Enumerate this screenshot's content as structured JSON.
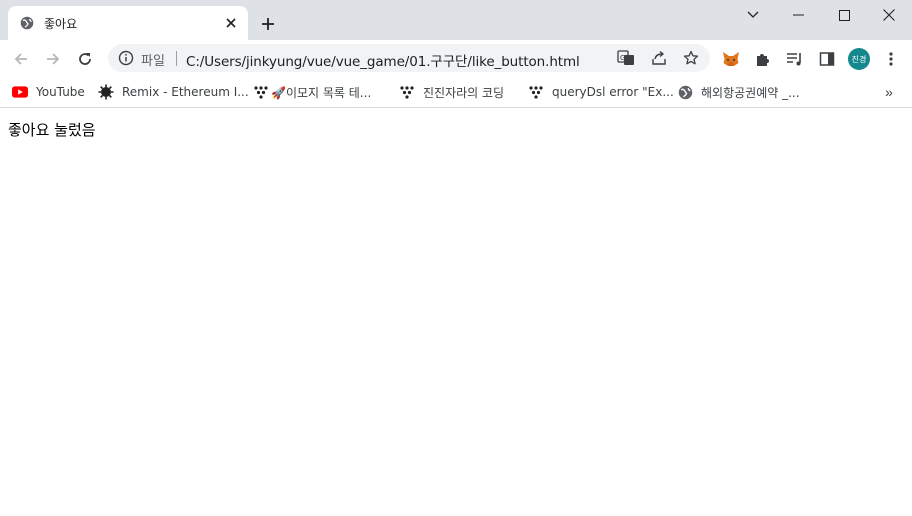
{
  "tab": {
    "title": "좋아요",
    "favicon": "globe-icon",
    "close_icon": "close-icon"
  },
  "window_controls": [
    "chevron-down-icon",
    "minimize-icon",
    "maximize-icon",
    "close-window-icon"
  ],
  "toolbar": {
    "back_icon": "arrow-left-icon",
    "forward_icon": "arrow-right-icon",
    "reload_icon": "reload-icon"
  },
  "omnibox": {
    "chip_label": "파일",
    "url": "C:/Users/jinkyung/vue/vue_game/01.구구단/like_button.html",
    "actions": [
      "translate-icon",
      "share-icon",
      "bookmark-star-icon"
    ]
  },
  "extensions": [
    "metamask-fox-icon",
    "puzzle-extensions-icon",
    "reading-list-icon",
    "side-panel-icon"
  ],
  "profile": {
    "avatar_text": "진경",
    "color": "#14888d"
  },
  "bookmarks": [
    {
      "label": "YouTube",
      "icon": "youtube-icon"
    },
    {
      "label": "Remix - Ethereum I...",
      "icon": "remix-icon"
    },
    {
      "label": "🚀이모지 목록 테...",
      "icon": "dots-icon"
    },
    {
      "label": "진진자라의 코딩",
      "icon": "dots-icon"
    },
    {
      "label": "queryDsl error \"Ex...",
      "icon": "dots-icon"
    },
    {
      "label": "해외항공권예약 _...",
      "icon": "globe-icon"
    }
  ],
  "bookmarks_more": "»",
  "page": {
    "text": "좋아요 눌렀음"
  },
  "colors": {
    "tabstrip_bg": "#dee1e6",
    "omnibox_bg": "#f1f3f4",
    "youtube_red": "#ff0000"
  }
}
